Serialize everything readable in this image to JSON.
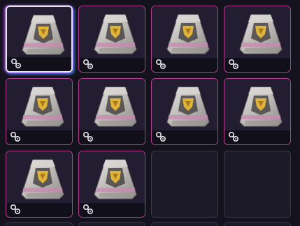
{
  "inventory": {
    "columns": 4,
    "slots": [
      {
        "state": "filled",
        "item_icon": "supply-crate-icon",
        "badge_icon": "unlock-key-icon",
        "selected": true
      },
      {
        "state": "filled",
        "item_icon": "supply-crate-icon",
        "badge_icon": "unlock-key-icon",
        "selected": false
      },
      {
        "state": "filled",
        "item_icon": "supply-crate-icon",
        "badge_icon": "unlock-key-icon",
        "selected": false
      },
      {
        "state": "filled",
        "item_icon": "supply-crate-icon",
        "badge_icon": "unlock-key-icon",
        "selected": false
      },
      {
        "state": "filled",
        "item_icon": "supply-crate-icon",
        "badge_icon": "unlock-key-icon",
        "selected": false
      },
      {
        "state": "filled",
        "item_icon": "supply-crate-icon",
        "badge_icon": "unlock-key-icon",
        "selected": false
      },
      {
        "state": "filled",
        "item_icon": "supply-crate-icon",
        "badge_icon": "unlock-key-icon",
        "selected": false
      },
      {
        "state": "filled",
        "item_icon": "supply-crate-icon",
        "badge_icon": "unlock-key-icon",
        "selected": false
      },
      {
        "state": "filled",
        "item_icon": "supply-crate-icon",
        "badge_icon": "unlock-key-icon",
        "selected": false
      },
      {
        "state": "filled",
        "item_icon": "supply-crate-icon",
        "badge_icon": "unlock-key-icon",
        "selected": false
      },
      {
        "state": "empty",
        "selected": false
      },
      {
        "state": "empty",
        "selected": false
      }
    ]
  },
  "colors": {
    "background": "#14121d",
    "rarity_accent": "#d03aa8",
    "rarity_border": "#b3408f",
    "empty_border": "#3b3848",
    "selected_border": "#e8e4ee",
    "crate_metal": "#c9c7c4",
    "crate_emblem": "#e0b43a"
  }
}
